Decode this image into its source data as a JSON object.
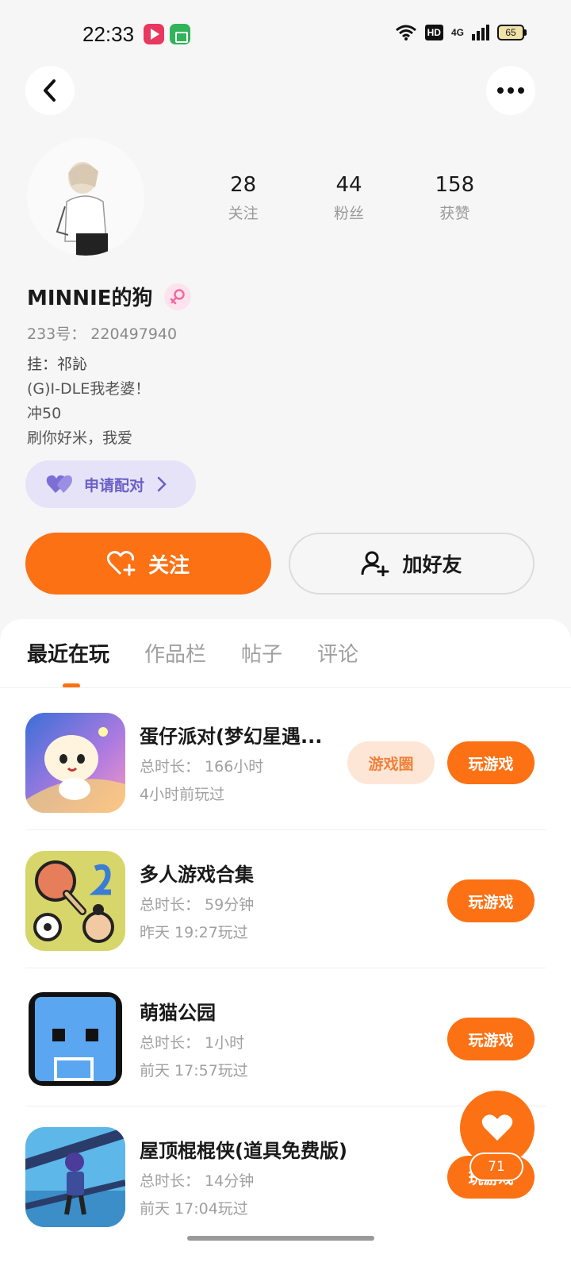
{
  "status_bar": {
    "time": "22:33",
    "hd": "HD",
    "network": "4G",
    "battery": "65"
  },
  "profile": {
    "stats": [
      {
        "value": "28",
        "label": "关注"
      },
      {
        "value": "44",
        "label": "粉丝"
      },
      {
        "value": "158",
        "label": "获赞"
      }
    ],
    "username": "MINNIE的狗",
    "uid": "233号： 220497940",
    "bio": [
      "挂：祁訫",
      "(G)I-DLE我老婆！",
      "冲50",
      "刷你好米，我爱"
    ],
    "pair_button": "申请配对",
    "follow_button": "关注",
    "add_friend_button": "加好友"
  },
  "tabs": [
    "最近在玩",
    "作品栏",
    "帖子",
    "评论"
  ],
  "games": [
    {
      "title": "蛋仔派对(梦幻星遇...",
      "total_time": "总时长： 166小时",
      "last_played": "4小时前玩过",
      "circle_label": "游戏圈",
      "play_label": "玩游戏"
    },
    {
      "title": "多人游戏合集",
      "total_time": "总时长： 59分钟",
      "last_played": "昨天 19:27玩过",
      "play_label": "玩游戏"
    },
    {
      "title": "萌猫公园",
      "total_time": "总时长： 1小时",
      "last_played": "前天 17:57玩过",
      "play_label": "玩游戏"
    },
    {
      "title": "屋顶棍棍侠(道具免费版)",
      "total_time": "总时长： 14分钟",
      "last_played": "前天 17:04玩过",
      "play_label": "玩游戏"
    }
  ],
  "fab": {
    "count": "71"
  },
  "colors": {
    "accent": "#fb7114",
    "pair_bg": "#e6e3f8",
    "pair_text": "#6a5fc7"
  }
}
